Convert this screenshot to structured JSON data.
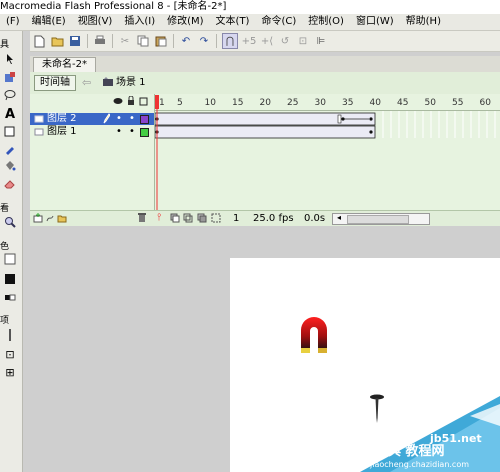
{
  "app": {
    "title": "Macromedia Flash Professional 8 - [未命名-2*]"
  },
  "menu": [
    "(F)",
    "编辑(E)",
    "视图(V)",
    "插入(I)",
    "修改(M)",
    "文本(T)",
    "命令(C)",
    "控制(O)",
    "窗口(W)",
    "帮助(H)"
  ],
  "toolbar": {
    "icons": [
      "new-icon",
      "open-icon",
      "save-icon",
      "print-icon",
      "cut-icon",
      "copy-icon",
      "paste-icon",
      "undo-icon",
      "redo-icon",
      "snap-icon",
      "smooth-icon",
      "straighten-icon",
      "rotate-icon",
      "scale-icon",
      "align-icon"
    ]
  },
  "tools": {
    "section_view": "看",
    "section_color": "色",
    "section_options": "项"
  },
  "document": {
    "tab": "未命名-2*"
  },
  "timeline": {
    "button": "时间轴",
    "scene": "场景 1",
    "ruler": [
      "1",
      "5",
      "10",
      "15",
      "20",
      "25",
      "30",
      "35",
      "40",
      "45",
      "50",
      "55",
      "60"
    ],
    "layers": [
      {
        "name": "图层 2",
        "selected": true,
        "color": "#8844cc"
      },
      {
        "name": "图层 1",
        "selected": false,
        "color": "#44cc44"
      }
    ],
    "footer": {
      "frame": "1",
      "fps": "25.0 fps",
      "time": "0.0s"
    }
  },
  "watermark": {
    "line1": "查字典 教程网",
    "line2": "jiaocheng.chazidian.com",
    "site": "jb51.net"
  }
}
